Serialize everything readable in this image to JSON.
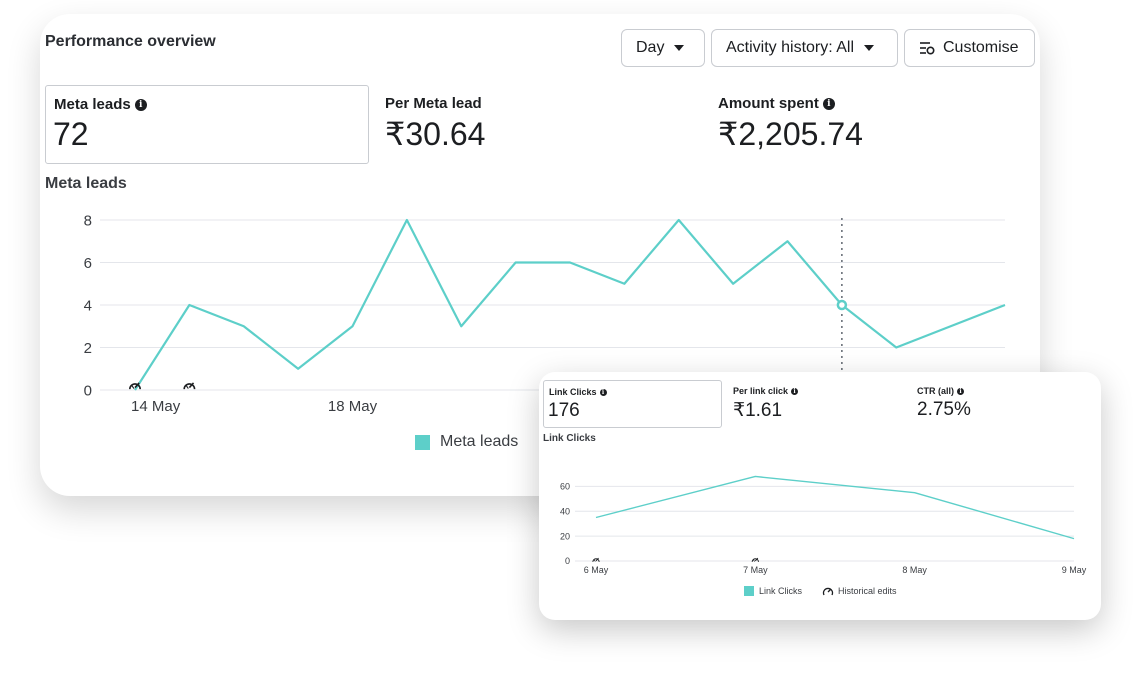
{
  "main": {
    "title": "Performance overview",
    "buttons": {
      "day": "Day",
      "activity": "Activity history: All",
      "customise": "Customise"
    },
    "metrics": [
      {
        "label": "Meta leads",
        "value": "72",
        "info": true,
        "selected": true
      },
      {
        "label": "Per Meta lead",
        "value": "₹30.64",
        "info": false,
        "selected": false
      },
      {
        "label": "Amount spent",
        "value": "₹2,205.74",
        "info": true,
        "selected": false
      }
    ],
    "chart_title": "Meta leads",
    "legend": "Meta leads"
  },
  "inset": {
    "metrics": [
      {
        "label": "Link Clicks",
        "value": "176",
        "info": true,
        "selected": true
      },
      {
        "label": "Per link click",
        "value": "₹1.61",
        "info": true,
        "selected": false
      },
      {
        "label": "CTR (all)",
        "value": "2.75%",
        "info": true,
        "selected": false
      }
    ],
    "chart_title": "Link Clicks",
    "legend_series": "Link Clicks",
    "legend_edits": "Historical edits"
  },
  "colors": {
    "line": "#5dcfc9",
    "grid": "#e4e6eb",
    "text": "#1c1e21"
  },
  "chart_data": [
    {
      "type": "line",
      "series": [
        {
          "name": "Meta leads",
          "values": [
            0,
            4,
            3,
            1,
            3,
            8,
            3,
            6,
            6,
            5,
            8,
            5,
            7,
            4,
            2,
            3,
            4
          ]
        }
      ],
      "x": [
        "14 May",
        "15 May",
        "16 May",
        "17 May",
        "18 May",
        "19 May",
        "20 May",
        "21 May",
        "22 May",
        "23 May",
        "24 May",
        "25 May",
        "26 May",
        "27 May",
        "28 May",
        "29 May",
        "30 May"
      ],
      "x_tick_labels": [
        "14 May",
        "18 May"
      ],
      "y_ticks": [
        0,
        2,
        4,
        6,
        8
      ],
      "ylim": [
        0,
        8
      ],
      "highlight_index": 13,
      "edit_markers": [
        0,
        1
      ],
      "grid": true,
      "legend": "bottom"
    },
    {
      "type": "line",
      "series": [
        {
          "name": "Link Clicks",
          "values": [
            35,
            68,
            55,
            18
          ]
        }
      ],
      "x": [
        "6 May",
        "7 May",
        "8 May",
        "9 May"
      ],
      "y_ticks": [
        0,
        20,
        40,
        60
      ],
      "ylim": [
        0,
        70
      ],
      "edit_markers": [
        0,
        1
      ],
      "grid": true,
      "legend": "bottom"
    }
  ]
}
